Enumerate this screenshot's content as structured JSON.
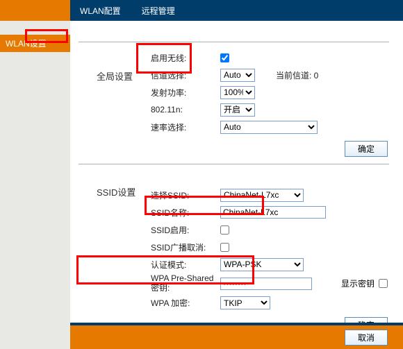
{
  "tabs": {
    "wlan_config": "WLAN配置",
    "remote_mgmt": "远程管理"
  },
  "sidebar": {
    "wlan": "WLAN设置"
  },
  "global": {
    "title": "全局设置",
    "enable_wireless": "启用无线:",
    "channel_select": "信道选择:",
    "channel_value": "Auto",
    "current_channel_label": "当前信道: ",
    "current_channel_value": "0",
    "tx_power": "发射功率:",
    "tx_power_value": "100%",
    "dot11n": "802.11n:",
    "dot11n_value": "开启",
    "rate": "速率选择:",
    "rate_value": "Auto"
  },
  "ssid": {
    "title": "SSID设置",
    "select_ssid": "选择SSID:",
    "select_ssid_value": "ChinaNet-L7xc",
    "ssid_name": "SSID名称:",
    "ssid_name_value": "ChinaNet-L7xc",
    "ssid_enable": "SSID启用:",
    "broadcast_cancel": "SSID广播取消:",
    "auth_mode": "认证模式:",
    "auth_mode_value": "WPA-PSK",
    "wpa_psk_label": "WPA Pre-Shared 密钥:",
    "wpa_psk_value": "••••••••",
    "show_key": "显示密钥",
    "wpa_encrypt": "WPA 加密:",
    "wpa_encrypt_value": "TKIP"
  },
  "buttons": {
    "ok": "确定",
    "cancel": "取消"
  }
}
